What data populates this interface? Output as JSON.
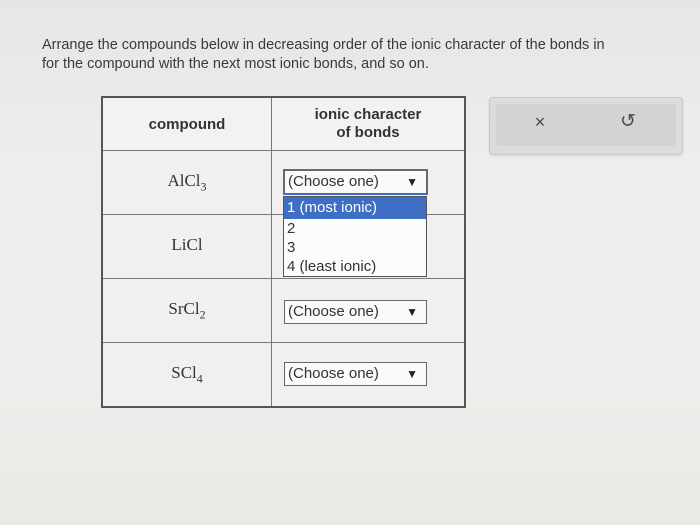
{
  "prompt": {
    "line1": "Arrange the compounds below in decreasing order of the ionic character of the bonds in",
    "line2": "for the compound with the next most ionic bonds, and so on."
  },
  "table": {
    "headers": {
      "compound": "compound",
      "ionic_line1": "ionic character",
      "ionic_line2": "of bonds"
    },
    "rows": [
      {
        "formula_base": "AlCl",
        "formula_sub": "3",
        "selected": "(Choose one)"
      },
      {
        "formula_base": "LiCl",
        "formula_sub": "",
        "selected": ""
      },
      {
        "formula_base": "SrCl",
        "formula_sub": "2",
        "selected": "(Choose one)"
      },
      {
        "formula_base": "SCl",
        "formula_sub": "4",
        "selected": "(Choose one)"
      }
    ],
    "arrow": "▼"
  },
  "dropdown": {
    "options": [
      "1 (most ionic)",
      "2",
      "3",
      "4 (least ionic)"
    ]
  },
  "actions": {
    "clear_icon": "×",
    "undo_icon": "↺"
  }
}
